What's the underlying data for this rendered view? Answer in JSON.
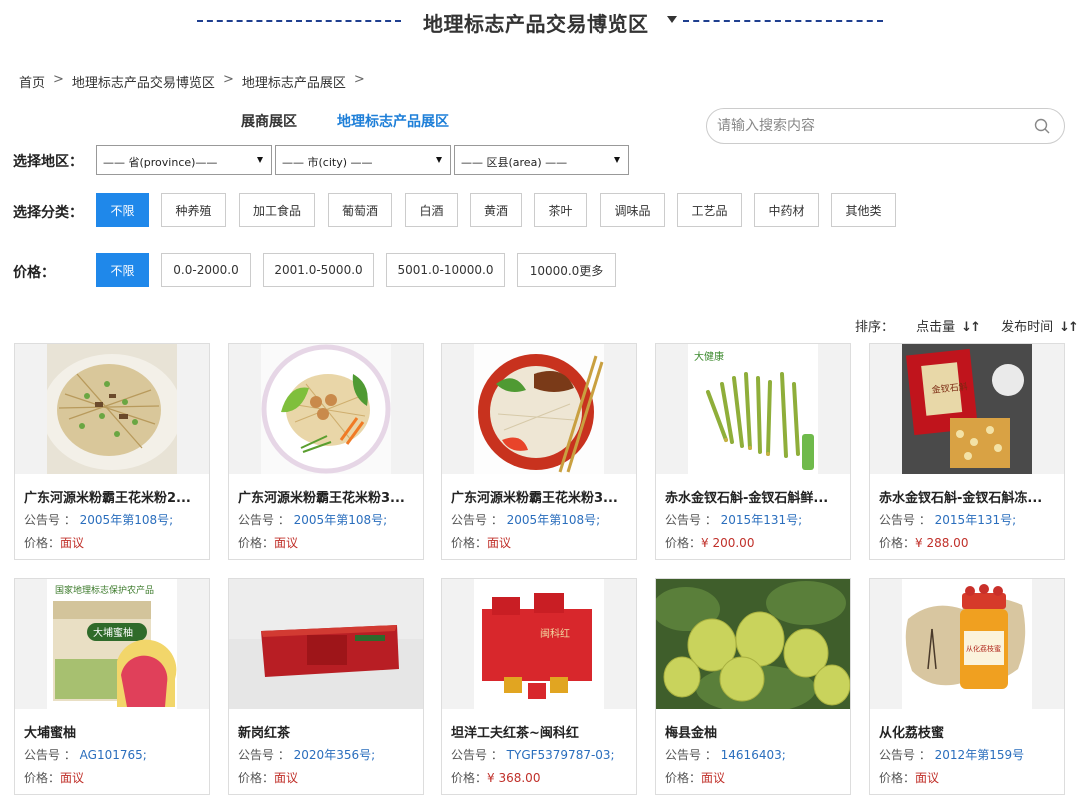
{
  "header": {
    "title": "地理标志产品交易博览区"
  },
  "breadcrumb": [
    "首页",
    "地理标志产品交易博览区",
    "地理标志产品展区"
  ],
  "tabs": [
    {
      "label": "展商展区",
      "active": false
    },
    {
      "label": "地理标志产品展区",
      "active": true
    }
  ],
  "search": {
    "placeholder": "请输入搜索内容"
  },
  "region": {
    "label": "选择地区：",
    "province": "—— 省(province)——",
    "city": "—— 市(city) ——",
    "area": "—— 区县(area) ——"
  },
  "category": {
    "label": "选择分类：",
    "options": [
      "不限",
      "种养殖",
      "加工食品",
      "葡萄酒",
      "白酒",
      "黄酒",
      "茶叶",
      "调味品",
      "工艺品",
      "中药材",
      "其他类"
    ],
    "selected": "不限"
  },
  "price": {
    "label": "价格：",
    "options": [
      "不限",
      "0.0-2000.0",
      "2001.0-5000.0",
      "5001.0-10000.0",
      "10000.0更多"
    ],
    "selected": "不限"
  },
  "sort": {
    "label": "排序：",
    "clicks": "点击量",
    "time": "发布时间"
  },
  "colors": {
    "accent": "#1f88ea",
    "link": "#2a6ebd",
    "price": "#c0302a",
    "title_dash": "#1f3f8f"
  },
  "products": [
    {
      "name": "广东河源米粉霸王花米粉2...",
      "notice_label": "公告号 ：",
      "notice": "2005年第108号;",
      "price_label": "价格：",
      "price": "面议"
    },
    {
      "name": "广东河源米粉霸王花米粉3...",
      "notice_label": "公告号 ：",
      "notice": "2005年第108号;",
      "price_label": "价格：",
      "price": "面议"
    },
    {
      "name": "广东河源米粉霸王花米粉3...",
      "notice_label": "公告号 ：",
      "notice": "2005年第108号;",
      "price_label": "价格：",
      "price": "面议"
    },
    {
      "name": "赤水金钗石斛-金钗石斛鲜...",
      "notice_label": "公告号 ：",
      "notice": "2015年131号;",
      "price_label": "价格：",
      "price": "¥ 200.00"
    },
    {
      "name": "赤水金钗石斛-金钗石斛冻...",
      "notice_label": "公告号 ：",
      "notice": "2015年131号;",
      "price_label": "价格：",
      "price": "¥ 288.00"
    },
    {
      "name": "大埔蜜柚",
      "notice_label": "公告号 ：",
      "notice": "AG101765;",
      "price_label": "价格：",
      "price": "面议"
    },
    {
      "name": "新岗红茶",
      "notice_label": "公告号 ：",
      "notice": "2020年356号;",
      "price_label": "价格：",
      "price": "面议"
    },
    {
      "name": "坦洋工夫红茶~闽科红",
      "notice_label": "公告号 ：",
      "notice": "TYGF5379787-03;",
      "price_label": "价格：",
      "price": "¥ 368.00"
    },
    {
      "name": "梅县金柚",
      "notice_label": "公告号 ：",
      "notice": "14616403;",
      "price_label": "价格：",
      "price": "面议"
    },
    {
      "name": "从化荔枝蜜",
      "notice_label": "公告号 ：",
      "notice": "2012年第159号",
      "price_label": "价格：",
      "price": "面议"
    }
  ],
  "image_labels": {
    "pomelo_box": "国家地理标志保护农产品",
    "pomelo_brand": "大埔蜜柚",
    "dendrobium_brand": "大健康",
    "dendrobium_box": "金钗石斛",
    "tea_box": "闽科红",
    "honey_label": "从化荔枝蜜"
  }
}
